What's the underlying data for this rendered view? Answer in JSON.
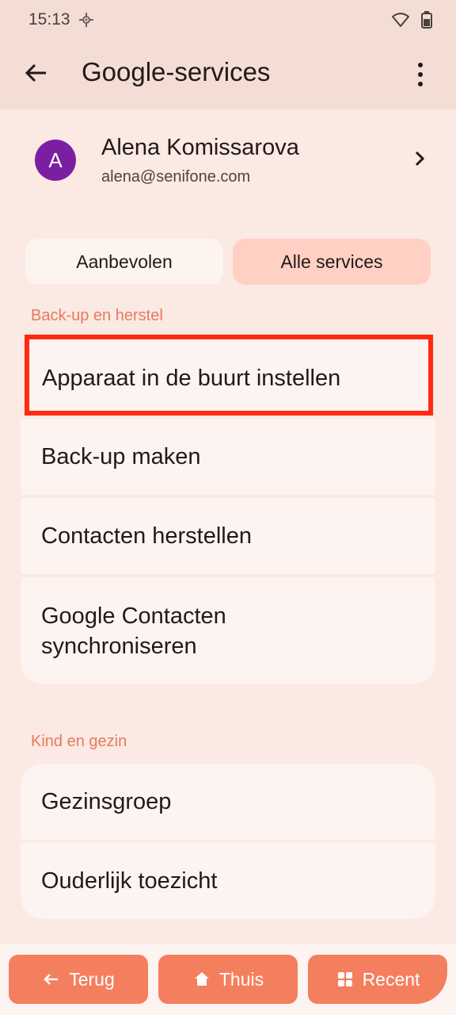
{
  "status": {
    "time": "15:13"
  },
  "app_bar": {
    "title": "Google-services"
  },
  "account": {
    "initial": "A",
    "name": "Alena Komissarova",
    "email": "alena@senifone.com",
    "avatar_color": "#7b1fa2"
  },
  "tabs": {
    "recommended": "Aanbevolen",
    "all": "Alle services"
  },
  "sections": {
    "backup": {
      "label": "Back-up en herstel",
      "items": [
        "Apparaat in de buurt instellen",
        "Back-up maken",
        "Contacten herstellen",
        "Google Contacten synchroniseren"
      ]
    },
    "family": {
      "label": "Kind en gezin",
      "items": [
        "Gezinsgroep",
        "Ouderlijk toezicht"
      ]
    }
  },
  "bottom_nav": {
    "back": "Terug",
    "home": "Thuis",
    "recent": "Recent"
  },
  "colors": {
    "accent": "#f47f5e",
    "section": "#e8795e",
    "highlight": "#ff2a10"
  }
}
